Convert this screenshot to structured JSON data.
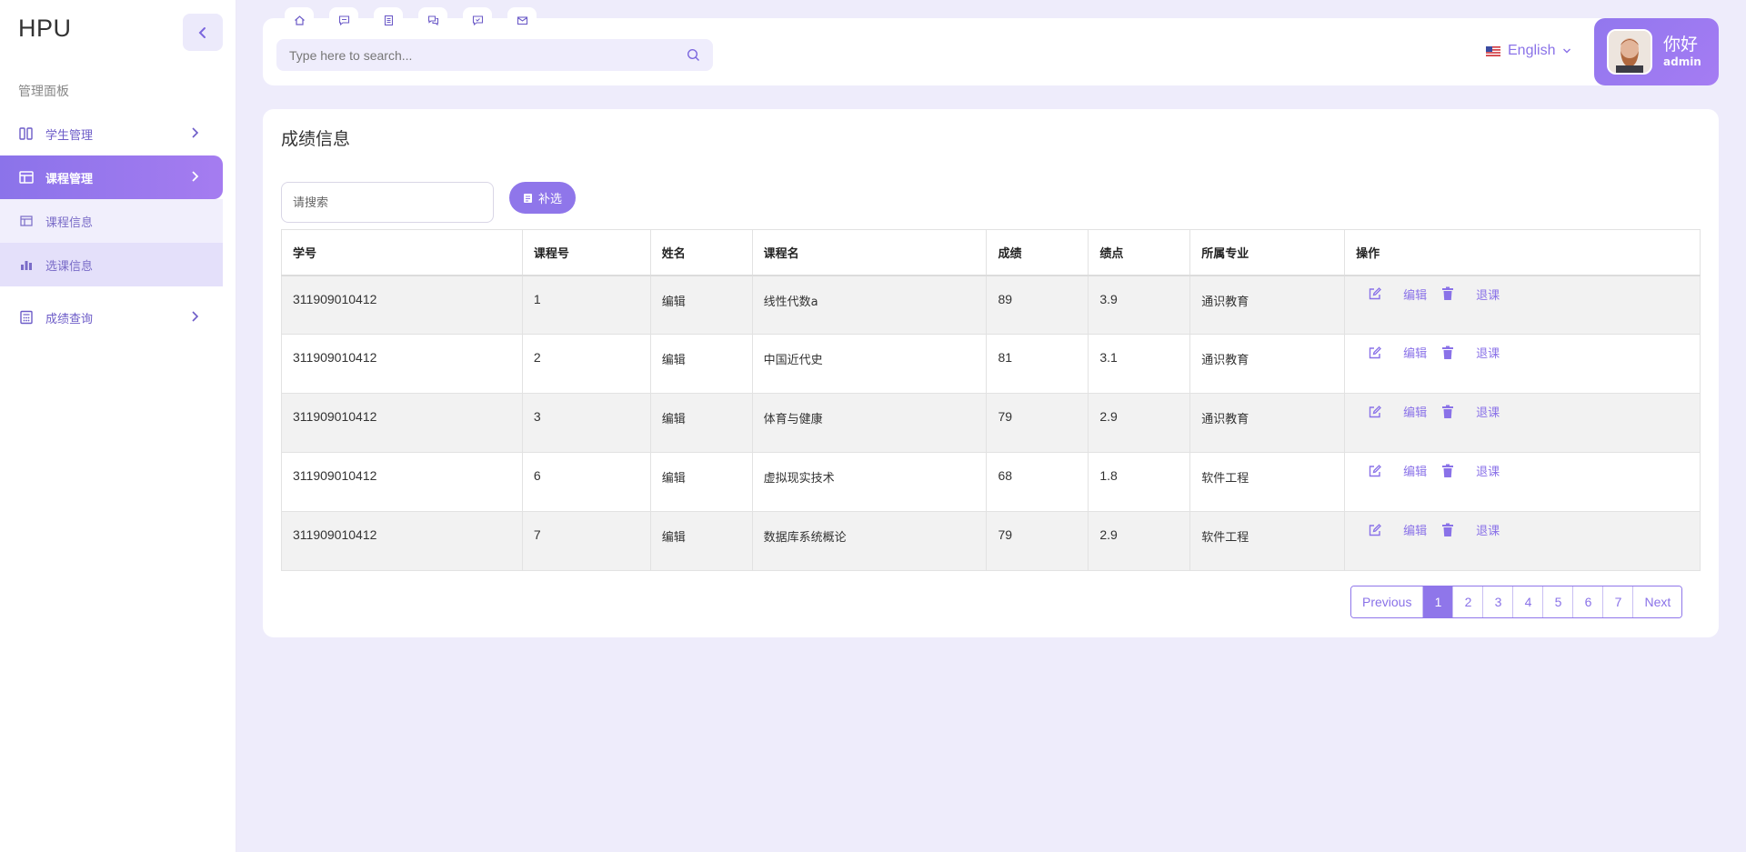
{
  "app": {
    "brand": "HPU"
  },
  "sidebar": {
    "section_title": "管理面板",
    "items": [
      {
        "label": "学生管理",
        "icon": "columns-icon"
      },
      {
        "label": "课程管理",
        "icon": "table-icon"
      },
      {
        "label": "课程信息",
        "icon": "table-small-icon"
      },
      {
        "label": "选课信息",
        "icon": "bar-chart-icon"
      },
      {
        "label": "成绩查询",
        "icon": "calculator-icon"
      }
    ]
  },
  "header": {
    "quick_tabs": [
      "home-icon",
      "message-icon",
      "document-icon",
      "chat-icon",
      "comment-icon",
      "mail-icon"
    ],
    "search_placeholder": "Type here to search...",
    "language": "English",
    "user": {
      "greeting": "你好",
      "role": "admin"
    }
  },
  "main": {
    "title": "成绩信息",
    "search_placeholder": "请搜索",
    "filter_label": "补选",
    "table": {
      "columns": [
        "学号",
        "课程号",
        "姓名",
        "课程名",
        "成绩",
        "绩点",
        "所属专业",
        "操作"
      ],
      "rows": [
        [
          "311909010412",
          "1",
          "编辑",
          "线性代数a",
          "89",
          "3.9",
          "通识教育"
        ],
        [
          "311909010412",
          "2",
          "编辑",
          "中国近代史",
          "81",
          "3.1",
          "通识教育"
        ],
        [
          "311909010412",
          "3",
          "编辑",
          "体育与健康",
          "79",
          "2.9",
          "通识教育"
        ],
        [
          "311909010412",
          "6",
          "编辑",
          "虚拟现实技术",
          "68",
          "1.8",
          "软件工程"
        ],
        [
          "311909010412",
          "7",
          "编辑",
          "数据库系统概论",
          "79",
          "2.9",
          "软件工程"
        ]
      ],
      "action_edit": "编辑",
      "action_drop": "退课"
    },
    "pagination": {
      "previous": "Previous",
      "pages": [
        "1",
        "2",
        "3",
        "4",
        "5",
        "6",
        "7"
      ],
      "current": "1",
      "next": "Next"
    }
  },
  "colors": {
    "accent": "#8f76ea",
    "background": "#eeecfb"
  }
}
